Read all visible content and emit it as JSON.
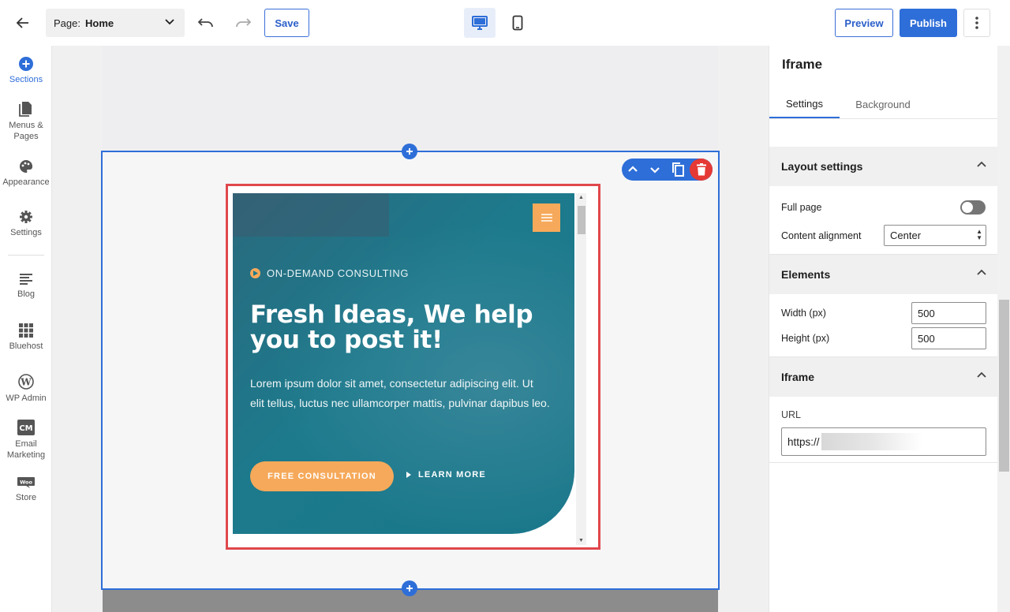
{
  "topbar": {
    "page_label": "Page:",
    "page_value": "Home",
    "save_label": "Save",
    "preview_label": "Preview",
    "publish_label": "Publish"
  },
  "sidebar": {
    "items": [
      {
        "label": "Sections",
        "icon": "plus-circle-icon"
      },
      {
        "label": "Menus & Pages",
        "icon": "pages-icon"
      },
      {
        "label": "Appearance",
        "icon": "palette-icon"
      },
      {
        "label": "Settings",
        "icon": "gear-icon"
      },
      {
        "label": "Blog",
        "icon": "blog-icon"
      },
      {
        "label": "Bluehost",
        "icon": "grid-icon"
      },
      {
        "label": "WP Admin",
        "icon": "wordpress-icon"
      },
      {
        "label": "Email Marketing",
        "icon": "cm-icon"
      },
      {
        "label": "Store",
        "icon": "woo-icon"
      }
    ]
  },
  "iframe_preview": {
    "eyebrow": "ON-DEMAND CONSULTING",
    "title": "Fresh Ideas, We help you to post it!",
    "body": "Lorem ipsum dolor sit amet, consectetur adipiscing elit. Ut elit tellus, luctus nec ullamcorper mattis, pulvinar dapibus leo.",
    "cta": "FREE CONSULTATION",
    "link": "LEARN MORE"
  },
  "panel": {
    "title": "Iframe",
    "tabs": [
      "Settings",
      "Background"
    ],
    "layout_settings": {
      "heading": "Layout settings",
      "full_page_label": "Full page",
      "full_page_on": false,
      "alignment_label": "Content alignment",
      "alignment_value": "Center"
    },
    "elements": {
      "heading": "Elements",
      "width_label": "Width (px)",
      "width_value": "500",
      "height_label": "Height (px)",
      "height_value": "500"
    },
    "iframe": {
      "heading": "Iframe",
      "url_label": "URL",
      "url_value": "https://"
    }
  },
  "colors": {
    "accent": "#2e6ed8",
    "delete": "#e53935",
    "hero_orange": "#f6a95a",
    "hero_teal": "#1c7a8c",
    "selection_red": "#e0474c"
  }
}
